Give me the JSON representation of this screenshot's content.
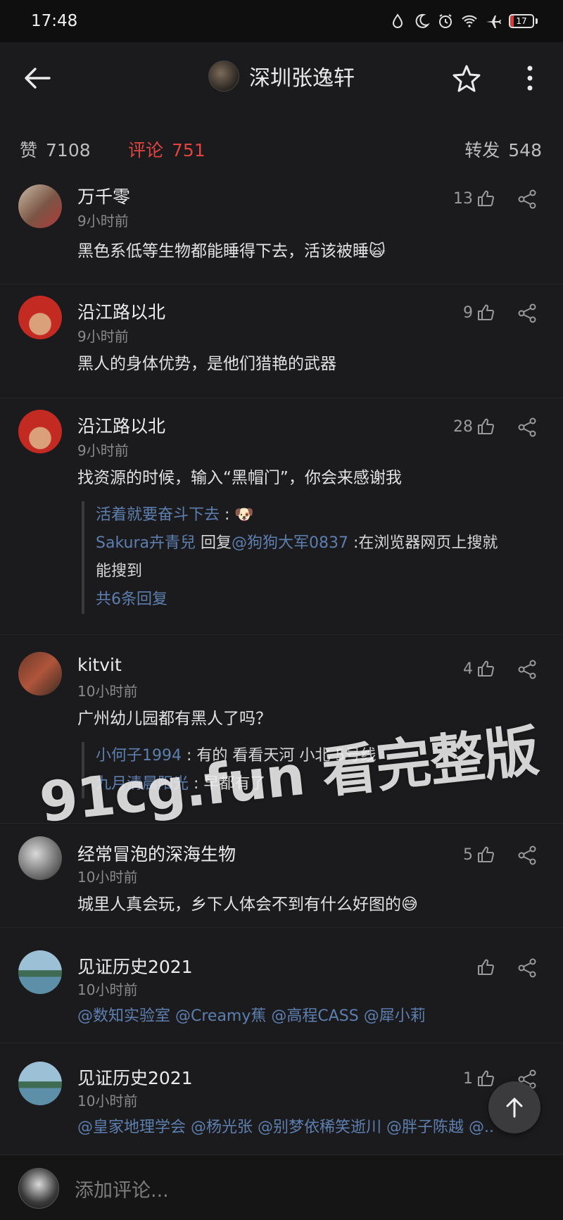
{
  "status_bar": {
    "time": "17:48",
    "battery": "17",
    "battery_level": 0.17,
    "icons": [
      "water-drop-icon",
      "moon-icon",
      "alarm-icon",
      "wifi-icon",
      "airplane-icon",
      "battery-icon"
    ]
  },
  "header": {
    "title": "深圳张逸轩",
    "back_icon": "back-arrow-icon",
    "star_icon": "star-icon",
    "more_icon": "more-vertical-icon"
  },
  "tabs": {
    "likes_label": "赞",
    "likes_count": "7108",
    "comments_label": "评论",
    "comments_count": "751",
    "reposts_label": "转发",
    "reposts_count": "548"
  },
  "comments": [
    {
      "name": "万千零",
      "time": "9小时前",
      "text": "黑色系低等生物都能睡得下去，活该被睡🙀",
      "likes": "13"
    },
    {
      "name": "沿江路以北",
      "time": "9小时前",
      "text": "黑人的身体优势，是他们猎艳的武器",
      "likes": "9"
    },
    {
      "name": "沿江路以北",
      "time": "9小时前",
      "text": "找资源的时候，输入“黑帽门”，你会来感谢我",
      "likes": "28",
      "replies": [
        {
          "who": "活着就要奋斗下去",
          "text": " : 🐶"
        },
        {
          "who": "Sakura卉青兒",
          "mid": " 回复",
          "at": "@狗狗大军0837",
          "text": " :在浏览器网页上搜就"
        },
        {
          "text": "能搜到"
        }
      ],
      "reply_more": "共6条回复"
    },
    {
      "name": "kitvit",
      "time": "10小时前",
      "text": "广州幼儿园都有黑人了吗？",
      "likes": "4",
      "replies": [
        {
          "who": "小何子1994",
          "text": " : 有的 看看天河 小北 5号线"
        },
        {
          "who": "九月清晨阳光",
          "text": " : 早都有了"
        }
      ]
    },
    {
      "name": "经常冒泡的深海生物",
      "time": "10小时前",
      "text": "城里人真会玩，乡下人体会不到有什么好图的😅",
      "likes": "5"
    },
    {
      "name": "见证历史2021",
      "time": "10小时前",
      "mentions": "@数知实验室 @Creamy蕉 @高程CASS @犀小莉",
      "likes": ""
    },
    {
      "name": "见证历史2021",
      "time": "10小时前",
      "mentions": "@皇家地理学会 @杨光张 @别梦依稀笑逝川 @胖子陈越 @...",
      "likes": "1"
    }
  ],
  "watermark": "91cg.fun 看完整版",
  "bottom": {
    "placeholder": "添加评论..."
  }
}
